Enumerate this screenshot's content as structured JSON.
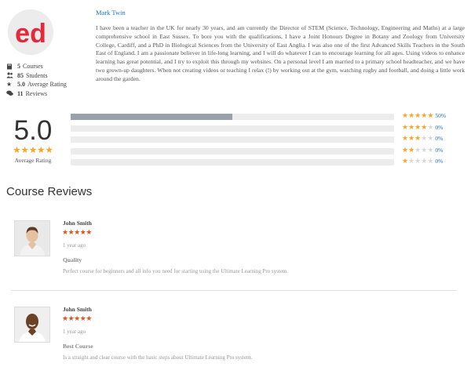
{
  "instructor": {
    "logo_text": "ed",
    "name": "Mark Twin",
    "bio": "I have been a teacher in the UK for nearly 30 years, and am currently the Director of STEM (Science, Technology, Engineering and Maths) at a large comprehensive school in East Sussex. To bore you with the qualifications, I have a Joint Honours Degree in Botany and Zoology from University College, Cardiff, and a PhD in Biological Sciences from the University of East Anglia. I was also one of the first Advanced Skills Teachers in the South East of England. I am a passionate believer in life-long learning, and I will do whatever I can to encourage learning for all ages. Using videos to enhance learning has great potential, and I try to exploit this through my websites. On a personal level I am married to a primary school headteacher, and we have two grown-up daughters. When not creating videos or teaching I relax (!) by working out at the gym, watching rugby and football, and doing a little work around the garden.",
    "stats": [
      {
        "icon": "courses-icon",
        "value": "5",
        "label": "Courses"
      },
      {
        "icon": "students-icon",
        "value": "85",
        "label": "Students"
      },
      {
        "icon": "star-icon",
        "value": "5.0",
        "label": "Average Rating"
      },
      {
        "icon": "reviews-icon",
        "value": "11",
        "label": "Reviews"
      }
    ]
  },
  "rating": {
    "score": "5.0",
    "stars": "★★★★★",
    "label": "Average Rating",
    "accent_color": "#f5a623",
    "breakdown": [
      {
        "stars": 5,
        "percent": 50,
        "label": "50%"
      },
      {
        "stars": 4,
        "percent": 0,
        "label": "0%"
      },
      {
        "stars": 3,
        "percent": 0,
        "label": "0%"
      },
      {
        "stars": 2,
        "percent": 0,
        "label": "0%"
      },
      {
        "stars": 1,
        "percent": 0,
        "label": "0%"
      }
    ]
  },
  "reviews_section": {
    "title": "Course Reviews",
    "reviews": [
      {
        "name": "John Smith",
        "stars": "★★★★★",
        "time": "1 year ago",
        "title": "Quality",
        "text": "Perfect course for beginners and all info you need for starting using the Ultimate Learning Pro system."
      },
      {
        "name": "John Smith",
        "stars": "★★★★★",
        "time": "1 year ago",
        "title": "Best Course",
        "text": "Is a straight and clear course with the basic steps about Ultimate Learning Pro system."
      }
    ]
  }
}
